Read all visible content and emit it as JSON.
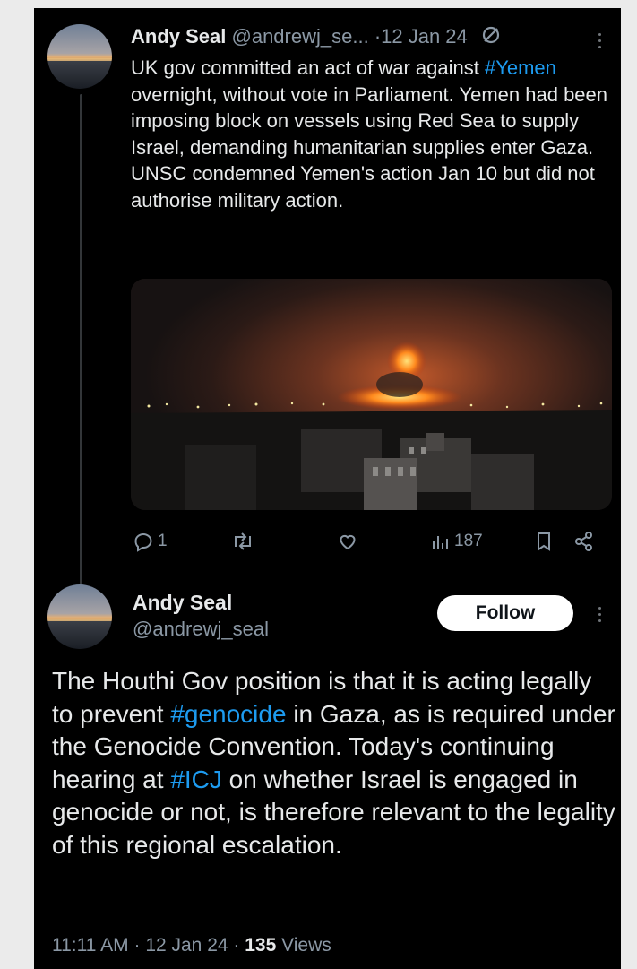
{
  "quoted_tweet": {
    "author_name": "Andy Seal",
    "handle": "@andrewj_se...",
    "separator": "·",
    "date": "12 Jan 24",
    "text_1": "UK gov committed an act of war against ",
    "hashtag": "#Yemen",
    "text_2": " overnight, without vote in Parliament. Yemen had been imposing block on vessels using Red Sea to supply Israel, demanding humanitarian supplies enter Gaza. UNSC condemned Yemen's action Jan 10 but did not authorise military action.",
    "actions": {
      "reply_count": "1",
      "retweet_count": "",
      "like_count": "",
      "views_count": "187"
    }
  },
  "main_tweet": {
    "author_name": "Andy Seal",
    "handle": "@andrewj_seal",
    "follow_label": "Follow",
    "text_1": "The Houthi Gov position is that it is acting legally to prevent ",
    "hashtag_1": "#genocide",
    "text_2": " in Gaza, as is required under the Genocide Convention. Today's continuing hearing at ",
    "hashtag_2": "#ICJ",
    "text_3": " on whether Israel is engaged in genocide or not, is therefore relevant to the legality of this regional escalation.",
    "time": "11:11 AM",
    "separator": "·",
    "date": "12 Jan 24",
    "views_count": "135",
    "views_label": "Views"
  },
  "colors": {
    "background": "#000000",
    "text": "#e7e9ea",
    "muted": "#8b98a5",
    "link": "#1d9bf0"
  }
}
